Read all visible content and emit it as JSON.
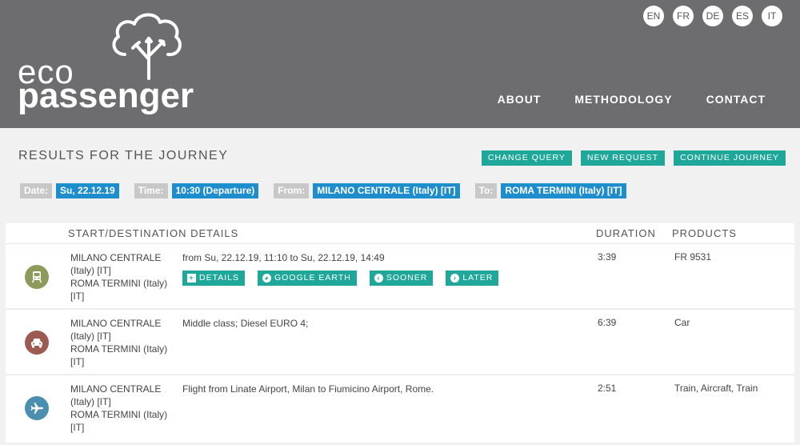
{
  "header": {
    "logo_top": "eco",
    "logo_bottom": "passenger",
    "languages": [
      "EN",
      "FR",
      "DE",
      "ES",
      "IT"
    ],
    "nav": [
      "ABOUT",
      "METHODOLOGY",
      "CONTACT"
    ],
    "bg_color": "#6d6d70"
  },
  "results": {
    "title": "RESULTS FOR THE JOURNEY",
    "actions": [
      "CHANGE QUERY",
      "NEW REQUEST",
      "CONTINUE JOURNEY"
    ]
  },
  "meta": {
    "date_label": "Date:",
    "date_value": "Su, 22.12.19",
    "time_label": "Time:",
    "time_value": "10:30 (Departure)",
    "from_label": "From:",
    "from_value": "MILANO CENTRALE (Italy) [IT]",
    "to_label": "To:",
    "to_value": "ROMA TERMINI (Italy) [IT]"
  },
  "table": {
    "headers": {
      "details": "START/DESTINATION DETAILS",
      "duration": "DURATION",
      "products": "PRODUCTS"
    },
    "rows": [
      {
        "icon": "train-icon",
        "icon_color": "#8c9a5a",
        "start": "MILANO CENTRALE (Italy) [IT]",
        "destination": "ROMA TERMINI (Italy) [IT]",
        "detail": "from Su, 22.12.19, 11:10 to Su, 22.12.19, 14:49",
        "buttons": [
          "DETAILS",
          "GOOGLE EARTH",
          "SOONER",
          "LATER"
        ],
        "duration": "3:39",
        "products": "FR 9531"
      },
      {
        "icon": "car-icon",
        "icon_color": "#9c5a52",
        "start": "MILANO CENTRALE (Italy) [IT]",
        "destination": "ROMA TERMINI (Italy) [IT]",
        "detail": "Middle class; Diesel EURO 4;",
        "duration": "6:39",
        "products": "Car"
      },
      {
        "icon": "airplane-icon",
        "icon_color": "#4a8fb0",
        "start": "MILANO CENTRALE (Italy) [IT]",
        "destination": "ROMA TERMINI (Italy) [IT]",
        "detail": "Flight from Linate Airport, Milan to Fiumicino Airport, Rome.",
        "duration": "2:51",
        "products": "Train, Aircraft, Train"
      }
    ]
  }
}
